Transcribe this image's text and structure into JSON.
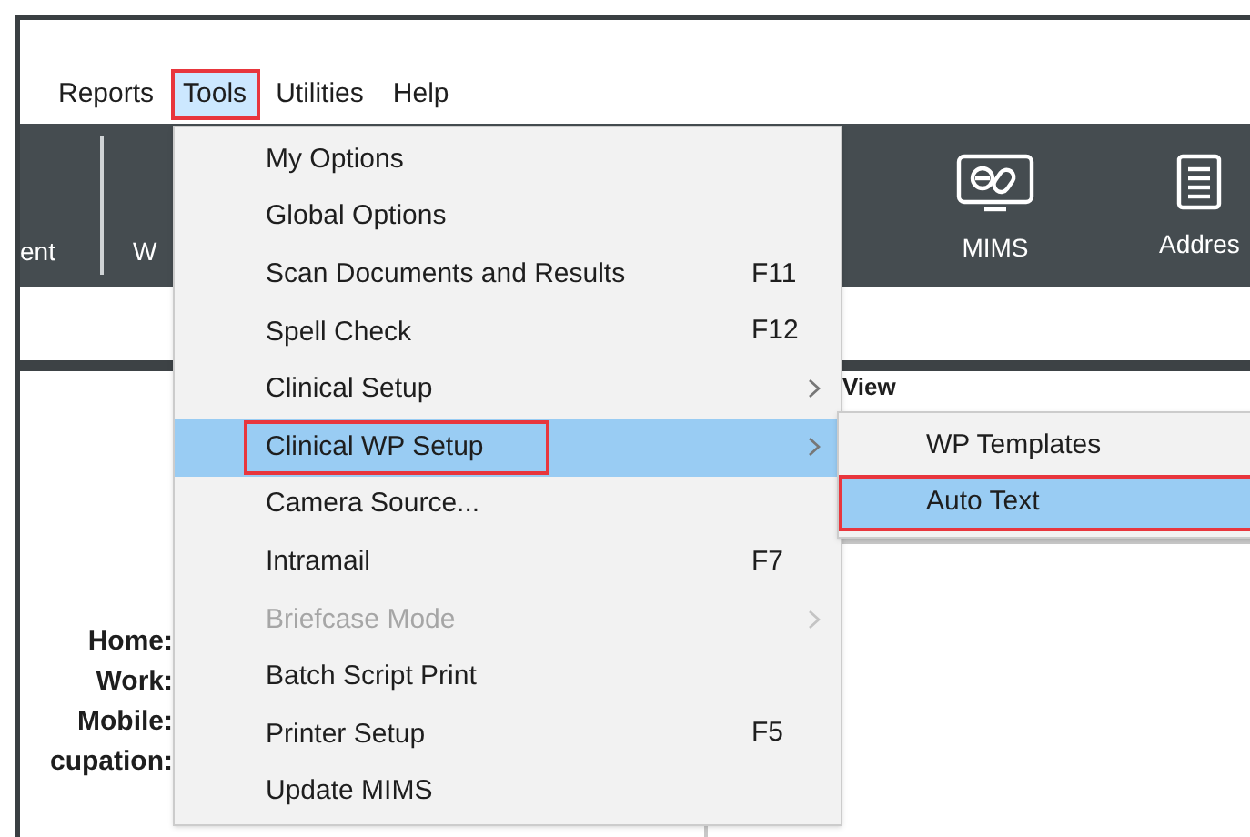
{
  "menu_bar": [
    {
      "label": "Reports",
      "selected": false,
      "callout": false
    },
    {
      "label": "Tools",
      "selected": true,
      "callout": true
    },
    {
      "label": "Utilities",
      "selected": false,
      "callout": false
    },
    {
      "label": "Help",
      "selected": false,
      "callout": false
    }
  ],
  "toolbar": [
    {
      "label": "ent",
      "kind": "text"
    },
    {
      "label": "W",
      "kind": "text"
    },
    {
      "label": "MIMS",
      "kind": "pill-monitor"
    },
    {
      "label": "Addres",
      "kind": "document"
    }
  ],
  "panel": {
    "heading": "View"
  },
  "contact_labels": [
    "Home:",
    "Work:",
    "Mobile:",
    "cupation:"
  ],
  "tools_menu": [
    {
      "label": "My Options",
      "submenu": false,
      "disabled": false,
      "selected": false,
      "callout": false
    },
    {
      "label": "Global Options",
      "submenu": false,
      "disabled": false,
      "selected": false,
      "callout": false
    },
    {
      "label": "Scan Documents and Results",
      "shortcut": "F11",
      "submenu": false,
      "disabled": false,
      "selected": false,
      "callout": false
    },
    {
      "label": "Spell Check",
      "shortcut": "F12",
      "submenu": false,
      "disabled": false,
      "selected": false,
      "callout": false
    },
    {
      "label": "Clinical Setup",
      "submenu": true,
      "disabled": false,
      "selected": false,
      "callout": false
    },
    {
      "label": "Clinical WP Setup",
      "submenu": true,
      "disabled": false,
      "selected": true,
      "callout": true
    },
    {
      "label": "Camera Source...",
      "submenu": false,
      "disabled": false,
      "selected": false,
      "callout": false
    },
    {
      "label": "Intramail",
      "shortcut": "F7",
      "submenu": false,
      "disabled": false,
      "selected": false,
      "callout": false
    },
    {
      "label": "Briefcase Mode",
      "submenu": true,
      "disabled": true,
      "selected": false,
      "callout": false
    },
    {
      "label": "Batch Script Print",
      "submenu": false,
      "disabled": false,
      "selected": false,
      "callout": false
    },
    {
      "label": "Printer Setup",
      "shortcut": "F5",
      "submenu": false,
      "disabled": false,
      "selected": false,
      "callout": false
    },
    {
      "label": "Update MIMS",
      "submenu": false,
      "disabled": false,
      "selected": false,
      "callout": false
    }
  ],
  "submenu": [
    {
      "label": "WP Templates",
      "selected": false,
      "callout": false
    },
    {
      "label": "Auto Text",
      "selected": true,
      "callout": true
    }
  ]
}
